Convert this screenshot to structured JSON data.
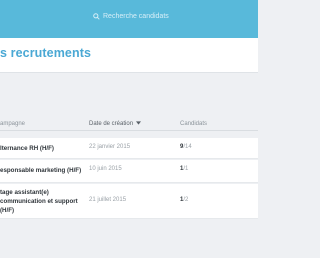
{
  "header": {
    "search_placeholder": "Recherche candidats"
  },
  "page": {
    "title": "s recrutements"
  },
  "table": {
    "columns": {
      "campaign": "ampagne",
      "created": "Date de création",
      "created_sort_icon": "caret-down-icon",
      "candidates": "Candidats"
    },
    "rows": [
      {
        "name": "lternance RH (H/F)",
        "date": "22 janvier 2015",
        "cand_new": "9",
        "cand_total": "/14"
      },
      {
        "name": "esponsable marketing (H/F)",
        "date": "10 juin 2015",
        "cand_new": "1",
        "cand_total": "/1"
      },
      {
        "name": "tage assistant(e) communication et support (H/F)",
        "date": "21 juillet 2015",
        "cand_new": "1",
        "cand_total": "/2"
      }
    ]
  },
  "colors": {
    "topbar": "#58b9da",
    "title": "#4aa8d4"
  }
}
